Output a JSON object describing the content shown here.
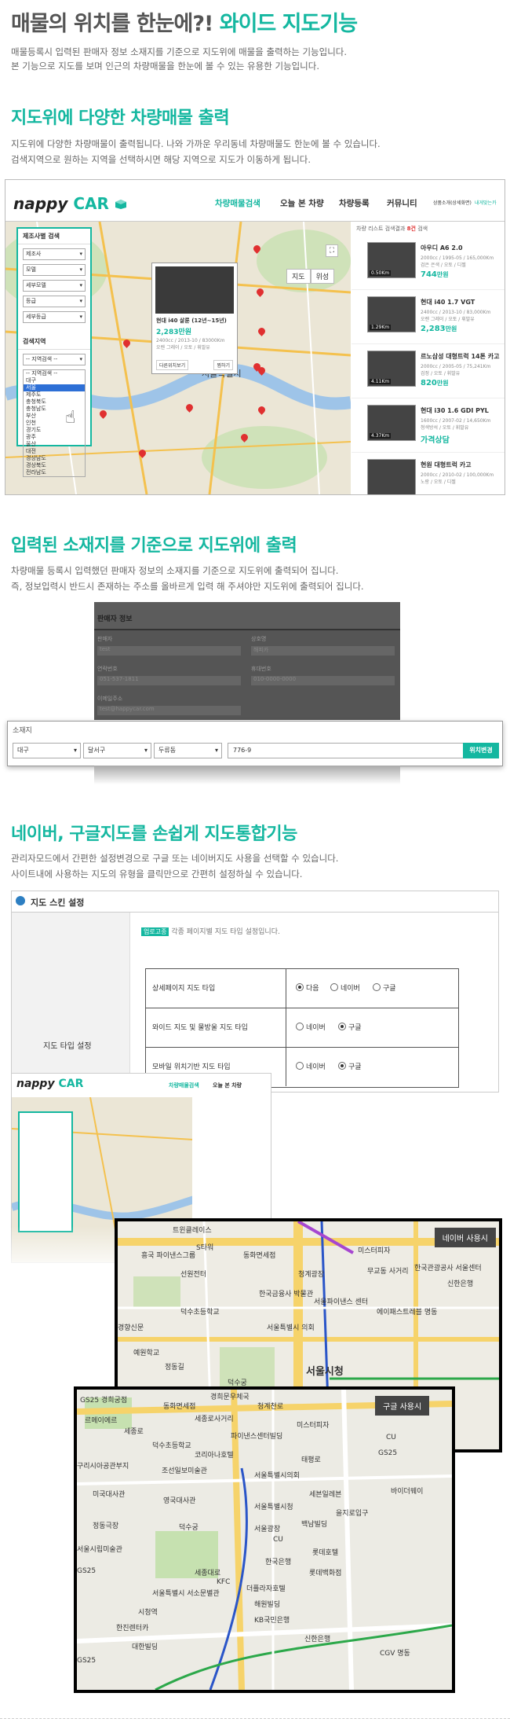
{
  "header": {
    "title_part1": "매물의 위치를 한눈에?!",
    "title_accent": "와이드 지도기능",
    "desc1": "매물등록시 입력된 판매자 정보 소재지를 기준으로 지도위에 매물을 출력하는 기능입니다.",
    "desc2": "본 기능으로 지도를 보며 인근의 차량매물을 한눈에 볼 수 있는 유용한 기능입니다."
  },
  "section1": {
    "title": "지도위에 다양한 차량매물 출력",
    "desc1": "지도위에 다양한 차량매물이 출력됩니다. 나와 가까운 우리동네 차량매물도 한눈에 볼 수 있습니다.",
    "desc2": "검색지역으로 원하는 지역을 선택하시면 해당 지역으로 지도가 이동하게 됩니다.",
    "shot": {
      "logo_prefix": "nappy",
      "logo_car": "CAR",
      "nav": [
        "차량매물검색",
        "오늘 본 차량",
        "차량등록",
        "커뮤니티"
      ],
      "nav_right": [
        "상품소개(상세화면)",
        "내게맞는카"
      ],
      "map_buttons": [
        "지도",
        "위성"
      ],
      "panel_title": "제조사별 검색",
      "panel_selects": [
        "제조사",
        "모델",
        "세부모델",
        "등급",
        "세부등급"
      ],
      "region_title": "검색지역",
      "region_select": "-- 지역검색 --",
      "region_list": [
        "-- 지역검색 --",
        "대구",
        "서울",
        "제주도",
        "충청북도",
        "충청남도",
        "부산",
        "인천",
        "경기도",
        "광주",
        "울산",
        "대전",
        "경상남도",
        "경상북도",
        "전라남도"
      ],
      "region_highlight": "서울",
      "popup_title": "현대 i40 살룬 (12년~15년)",
      "popup_price": "2,283만원",
      "popup_spec": "2400cc / 2013-10 / 83000Km",
      "popup_spec2": "오렌 그레이 / 오토 / 휘발유",
      "popup_btn1": "다른위치보기",
      "popup_btn2": "찜하기",
      "map_label": "서울특별시",
      "list_head_prefix": "차량 리스트 검색결과",
      "list_head_count": "8건",
      "list_head_suffix": "검색",
      "items": [
        {
          "name": "아우디 A6 2.0",
          "spec1": "2000cc / 1995-05 / 165,000Km",
          "spec2": "검은 은색 / 오토 / 디젤",
          "price": "744",
          "unit": "만원",
          "km": "0.50Km"
        },
        {
          "name": "현대 i40 1.7 VGT",
          "spec1": "2400cc / 2013-10 / 83,000Km",
          "spec2": "오렌 그레이 / 오토 / 휘발유",
          "price": "2,283",
          "unit": "만원",
          "km": "1.29Km"
        },
        {
          "name": "르노삼성 대형트럭 14톤 카고",
          "spec1": "2000cc / 2005-05 / 75,241Km",
          "spec2": "검정 / 오토 / 휘발유",
          "price": "820",
          "unit": "만원",
          "km": "4.11Km"
        },
        {
          "name": "현대 i30 1.6 GDI PYL",
          "spec1": "1600cc / 2007-02 / 14,650Km",
          "spec2": "청색방석 / 오토 / 휘발유",
          "price": "가격상담",
          "unit": "",
          "km": "4.37Km"
        },
        {
          "name": "현원 대형트럭 카고",
          "spec1": "2000cc / 2010-02 / 100,000Km",
          "spec2": "노랑 / 오토 / 디젤",
          "price": "",
          "unit": "",
          "km": ""
        }
      ]
    }
  },
  "section2": {
    "title": "입력된 소재지를 기준으로 지도위에 출력",
    "desc1": "차량매물 등록시 입력했던 판매자 정보의 소재지를 기준으로 지도위에 출력되어 집니다.",
    "desc2": "즉, 정보입력시 반드시 존재하는 주소를 올바르게 입력 해 주셔야만 지도위에 출력되어 집니다.",
    "shot": {
      "header": "판매자 정보",
      "labels": [
        "판매자",
        "상호명",
        "연락번호",
        "휴대번호",
        "이메일주소"
      ],
      "values": [
        "test",
        "해피카",
        "051-537-1811",
        "010-0000-0000",
        "test@happycar.com"
      ]
    },
    "field": {
      "label": "소재지",
      "select1": "대구",
      "select2": "달서구",
      "select3": "두류동",
      "address": "776-9",
      "button": "위치변경"
    }
  },
  "section3": {
    "title": "네이버, 구글지도를 손쉽게 지도통합기능",
    "desc1": "관리자모드에서 간편한 설정변경으로 구글 또는 네이버지도 사용을 선택할 수 있습니다.",
    "desc2": "사이트내에 사용하는 지도의 유형을 클릭만으로 간편히 설정하실 수 있습니다.",
    "admin": {
      "title": "지도 스킨 설정",
      "left_label": "지도 타입 설정",
      "note_tag": "업로고종",
      "note": "각종 페이지별 지도 타입 설정입니다.",
      "rows": [
        {
          "label": "상세페이지 지도 타입",
          "options": [
            "다음",
            "네이버",
            "구글"
          ],
          "selected": "다음"
        },
        {
          "label": "와이드 지도 및 물방울 지도 타입",
          "options": [
            "네이버",
            "구글"
          ],
          "selected": "구글"
        },
        {
          "label": "모바일 위치기반 지도 타입",
          "options": [
            "네이버",
            "구글"
          ],
          "selected": "구글"
        }
      ]
    },
    "naver_badge": "네이버 사용시",
    "google_badge": "구글 사용시",
    "naver_labels": [
      "트윈클레이스",
      "흥국 파이낸스그룹",
      "S타워",
      "선원전터",
      "동화면세점",
      "청계광장",
      "한국금융사 박물관",
      "서울파이낸스 센터",
      "무교동 사거리",
      "미스터피자",
      "한국관광공사 서울센터",
      "신한은행",
      "덕수초등학교",
      "서울특별시 의회",
      "에이패스트레블 명동",
      "경향신문",
      "예원학교",
      "정동길",
      "덕수궁",
      "서울시청"
    ],
    "google_labels": [
      "GS25 경희궁점",
      "동화면세점",
      "경희문우체국",
      "청계천로",
      "르메이에르",
      "세종로사거리",
      "세종로",
      "미스터피자",
      "CU",
      "덕수초등학교",
      "파이낸스센터빌딩",
      "GS25",
      "코리아나호텔",
      "태평로",
      "구리시아공관부지",
      "조선일보미술관",
      "서울특별시의회",
      "미국대사관",
      "영국대사관",
      "서울특별시청",
      "세븐일레븐",
      "바이더웨이",
      "정동극장",
      "덕수궁",
      "서울광장",
      "백남빌딩",
      "을지로입구",
      "서울시립미술관",
      "CU",
      "롯데호텔",
      "GS25",
      "한국은행",
      "세종대로",
      "KFC",
      "서울특별시 서소문별관",
      "더플라자호텔",
      "롯데백화점",
      "시청역",
      "한진렌터카",
      "해원빌딩",
      "KB국민은행",
      "신한은행",
      "대한빌딩",
      "GS25",
      "CGV 명동"
    ]
  },
  "colors": {
    "accent": "#14b7a0",
    "red": "#e03030"
  }
}
